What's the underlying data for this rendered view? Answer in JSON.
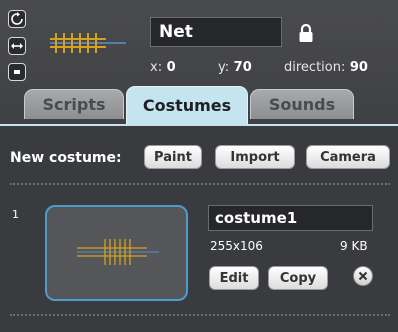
{
  "sprite": {
    "name": "Net",
    "x_label": "x:",
    "x_value": "0",
    "y_label": "y:",
    "y_value": "70",
    "direction_label": "direction:",
    "direction_value": "90"
  },
  "tabs": [
    {
      "label": "Scripts",
      "active": false
    },
    {
      "label": "Costumes",
      "active": true
    },
    {
      "label": "Sounds",
      "active": false
    }
  ],
  "new_costume": {
    "label": "New costume:",
    "buttons": [
      "Paint",
      "Import",
      "Camera"
    ]
  },
  "costumes": [
    {
      "index": "1",
      "name": "costume1",
      "dimensions": "255x106",
      "size": "9 KB",
      "edit_label": "Edit",
      "copy_label": "Copy"
    }
  ],
  "colors": {
    "background": "#3a3b3e",
    "active_tab": "#c4e4f0",
    "selection_border": "#4e9bcd",
    "net_yellow": "#d6a21c"
  },
  "icons": [
    "rotate-full-icon",
    "rotate-left-right-icon",
    "no-rotate-icon",
    "lock-icon",
    "delete-x-icon"
  ]
}
